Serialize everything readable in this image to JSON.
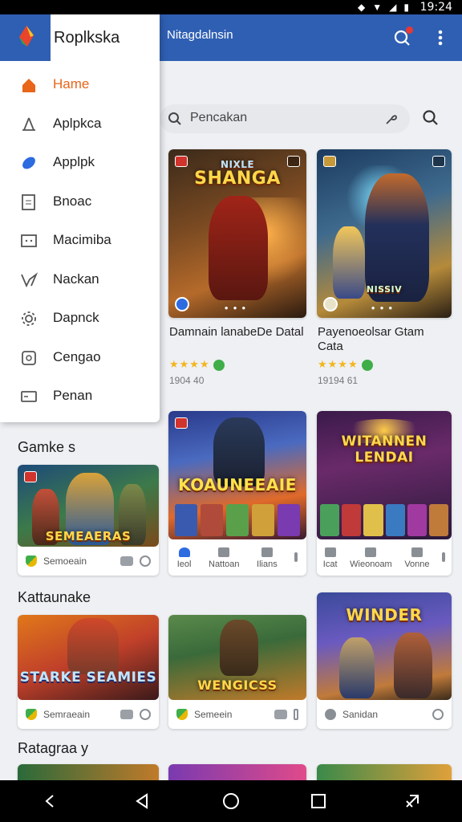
{
  "status_bar": {
    "time": "19:24"
  },
  "app_bar": {
    "title": "Nitagdalnsin"
  },
  "drawer": {
    "app_name": "Roplkska",
    "items": [
      {
        "label": "Hame",
        "icon": "home-icon",
        "active": true
      },
      {
        "label": "Aplpkca",
        "icon": "share-icon"
      },
      {
        "label": "Applpk",
        "icon": "leaf-icon"
      },
      {
        "label": "Bnoac",
        "icon": "document-icon"
      },
      {
        "label": "Macimiba",
        "icon": "window-icon"
      },
      {
        "label": "Nackan",
        "icon": "tag-icon"
      },
      {
        "label": "Dapnck",
        "icon": "gear-icon"
      },
      {
        "label": "Cengao",
        "icon": "puzzle-icon"
      },
      {
        "label": "Penan",
        "icon": "card-icon"
      }
    ]
  },
  "search": {
    "placeholder": "Pencakan"
  },
  "featured": [
    {
      "art_title": "SHANGA",
      "art_subtitle": "NIXLE",
      "title": "Damnain lanabeDe Datal",
      "rating": "★★★★",
      "meta": "1904 40"
    },
    {
      "art_title": "NISSIV",
      "title": "Payenoeolsar Gtam Cata",
      "rating": "★★★★",
      "meta": "19194 61"
    }
  ],
  "sections": [
    {
      "title": "Gamke s",
      "cards": [
        {
          "art_title": "SEMEAERAS",
          "footer_label": "Semoeain"
        },
        {
          "art_title": "KOAUNEEAIE",
          "tabs": [
            "Ieol",
            "Nattoan",
            "Ilians"
          ]
        },
        {
          "art_title": "WITANNEN LENDAI",
          "tabs": [
            "Icat",
            "Wieonoam",
            "Vonne"
          ]
        }
      ]
    },
    {
      "title": "Kattaunake",
      "cards": [
        {
          "art_title": "STARKE SEAMIES",
          "footer_label": "Semraeain"
        },
        {
          "art_title": "WENGICSS",
          "footer_label": "Semeein"
        },
        {
          "art_title": "WINDER",
          "footer_label": "Sanidan"
        }
      ]
    },
    {
      "title": "Ratagraa y"
    }
  ],
  "colors": {
    "primary": "#2f5fb3",
    "accent": "#e8651a",
    "star": "#f3b51b"
  }
}
